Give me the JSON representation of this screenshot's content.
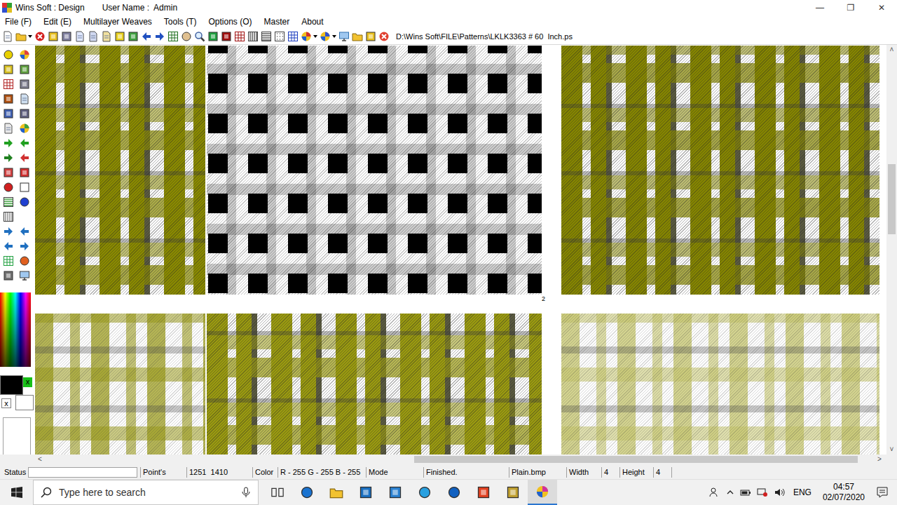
{
  "window": {
    "title": "Wins Soft : Design",
    "user_label": "User Name :",
    "user": "Admin",
    "controls": [
      "—",
      "❐",
      "✕"
    ]
  },
  "menu": [
    "File (F)",
    "Edit (E)",
    "Multilayer Weaves",
    "Tools (T)",
    "Options (O)",
    "Master",
    "About"
  ],
  "toolbar": {
    "path": "D:\\Wins Soft\\FILE\\Patterns\\LKLK3363 # 60  Inch.ps"
  },
  "palette": {
    "swatches": [
      {
        "name": "foreground",
        "color": "#000000",
        "mark": "x"
      },
      {
        "name": "background",
        "color": "#ffffff",
        "mark": "x"
      }
    ]
  },
  "canvas": {
    "page_label": "2",
    "rows": [
      {
        "tiles": [
          {
            "kind": "dark",
            "color": "#8a8a00"
          },
          {
            "kind": "bw",
            "color": "#000000"
          },
          {
            "kind": "dark",
            "color": "#858500"
          }
        ]
      },
      {
        "tiles": [
          {
            "kind": "light",
            "color": "#9c9c1c"
          },
          {
            "kind": "dark",
            "color": "#9a9a10"
          },
          {
            "kind": "light",
            "color": "#c4c46a"
          }
        ]
      }
    ]
  },
  "scrollbars": {
    "arrows": {
      "left": "<",
      "right": ">",
      "up": "˄",
      "down": "˅"
    },
    "horizontal": {
      "start": 0.445,
      "size": 0.535
    },
    "vertical": {
      "start": 0.28,
      "size": 0.18
    }
  },
  "status_bar": {
    "status_label": "Status",
    "status_value": "",
    "points_label": "Point's",
    "points": "1251  1410",
    "color_label": "Color",
    "color_value": "R - 255 G - 255 B - 255",
    "mode_label": "Mode",
    "message": "Finished.",
    "weave": "Plain.bmp",
    "width_label": "Width",
    "width": "4",
    "height_label": "Height",
    "height": "4"
  },
  "taskbar": {
    "search_placeholder": "Type here to search",
    "language": "ENG",
    "time": "04:57",
    "date": "02/07/2020"
  }
}
